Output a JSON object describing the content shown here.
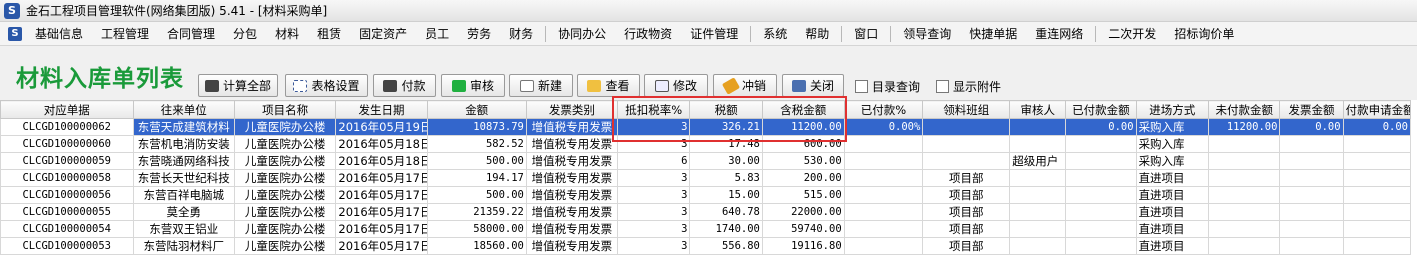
{
  "window": {
    "title": "金石工程项目管理软件(网络集团版) 5.41 - [材料采购单]",
    "logo": "S"
  },
  "menu": [
    "基础信息",
    "工程管理",
    "合同管理",
    "分包",
    "材料",
    "租赁",
    "固定资产",
    "员工",
    "劳务",
    "财务",
    "|",
    "协同办公",
    "行政物资",
    "证件管理",
    "|",
    "系统",
    "帮助",
    "|",
    "窗口",
    "|",
    "领导查询",
    "快捷单据",
    "重连网络",
    "|",
    "二次开发",
    "招标询价单"
  ],
  "page": {
    "title": "材料入库单列表"
  },
  "toolbar": {
    "calc_all": "计算全部",
    "grid_settings": "表格设置",
    "pay": "付款",
    "audit": "审核",
    "new": "新建",
    "view": "查看",
    "edit": "修改",
    "void": "冲销",
    "close": "关闭",
    "directory_query": "目录查询",
    "show_attachments": "显示附件"
  },
  "table": {
    "columns": [
      "对应单据",
      "往来单位",
      "项目名称",
      "发生日期",
      "金额",
      "发票类别",
      "抵扣税率%",
      "税额",
      "含税金额",
      "已付款%",
      "领料班组",
      "审核人",
      "已付款金额",
      "进场方式",
      "未付款金额",
      "发票金额",
      "付款申请金额"
    ],
    "rows": [
      [
        "CLCGD100000062",
        "东营天成建筑材料",
        "儿童医院办公楼",
        "2016年05月19日",
        "10873.79",
        "增值税专用发票",
        "3",
        "326.21",
        "11200.00",
        "0.00%",
        "",
        "",
        "0.00",
        "采购入库",
        "11200.00",
        "0.00",
        "0.00"
      ],
      [
        "CLCGD100000060",
        "东营机电消防安装",
        "儿童医院办公楼",
        "2016年05月18日",
        "582.52",
        "增值税专用发票",
        "3",
        "17.48",
        "600.00",
        "",
        "",
        "",
        "",
        "采购入库",
        "",
        "",
        ""
      ],
      [
        "CLCGD100000059",
        "东营晓通网络科技",
        "儿童医院办公楼",
        "2016年05月18日",
        "500.00",
        "增值税专用发票",
        "6",
        "30.00",
        "530.00",
        "",
        "",
        "超级用户",
        "",
        "采购入库",
        "",
        "",
        ""
      ],
      [
        "CLCGD100000058",
        "东营长天世纪科技",
        "儿童医院办公楼",
        "2016年05月17日",
        "194.17",
        "增值税专用发票",
        "3",
        "5.83",
        "200.00",
        "",
        "项目部",
        "",
        "",
        "直进项目",
        "",
        "",
        ""
      ],
      [
        "CLCGD100000056",
        "东营百祥电脑城",
        "儿童医院办公楼",
        "2016年05月17日",
        "500.00",
        "增值税专用发票",
        "3",
        "15.00",
        "515.00",
        "",
        "项目部",
        "",
        "",
        "直进项目",
        "",
        "",
        ""
      ],
      [
        "CLCGD100000055",
        "莫全勇",
        "儿童医院办公楼",
        "2016年05月17日",
        "21359.22",
        "增值税专用发票",
        "3",
        "640.78",
        "22000.00",
        "",
        "项目部",
        "",
        "",
        "直进项目",
        "",
        "",
        ""
      ],
      [
        "CLCGD100000054",
        "东营双王铝业",
        "儿童医院办公楼",
        "2016年05月17日",
        "58000.00",
        "增值税专用发票",
        "3",
        "1740.00",
        "59740.00",
        "",
        "项目部",
        "",
        "",
        "直进项目",
        "",
        "",
        ""
      ],
      [
        "CLCGD100000053",
        "东营陆羽材料厂",
        "儿童医院办公楼",
        "2016年05月17日",
        "18560.00",
        "增值税专用发票",
        "3",
        "556.80",
        "19116.80",
        "",
        "项目部",
        "",
        "",
        "直进项目",
        "",
        "",
        ""
      ]
    ]
  },
  "colors": {
    "title_green": "#1a9a3a",
    "selection_blue": "#3366cc",
    "highlight_red": "#e03030"
  }
}
